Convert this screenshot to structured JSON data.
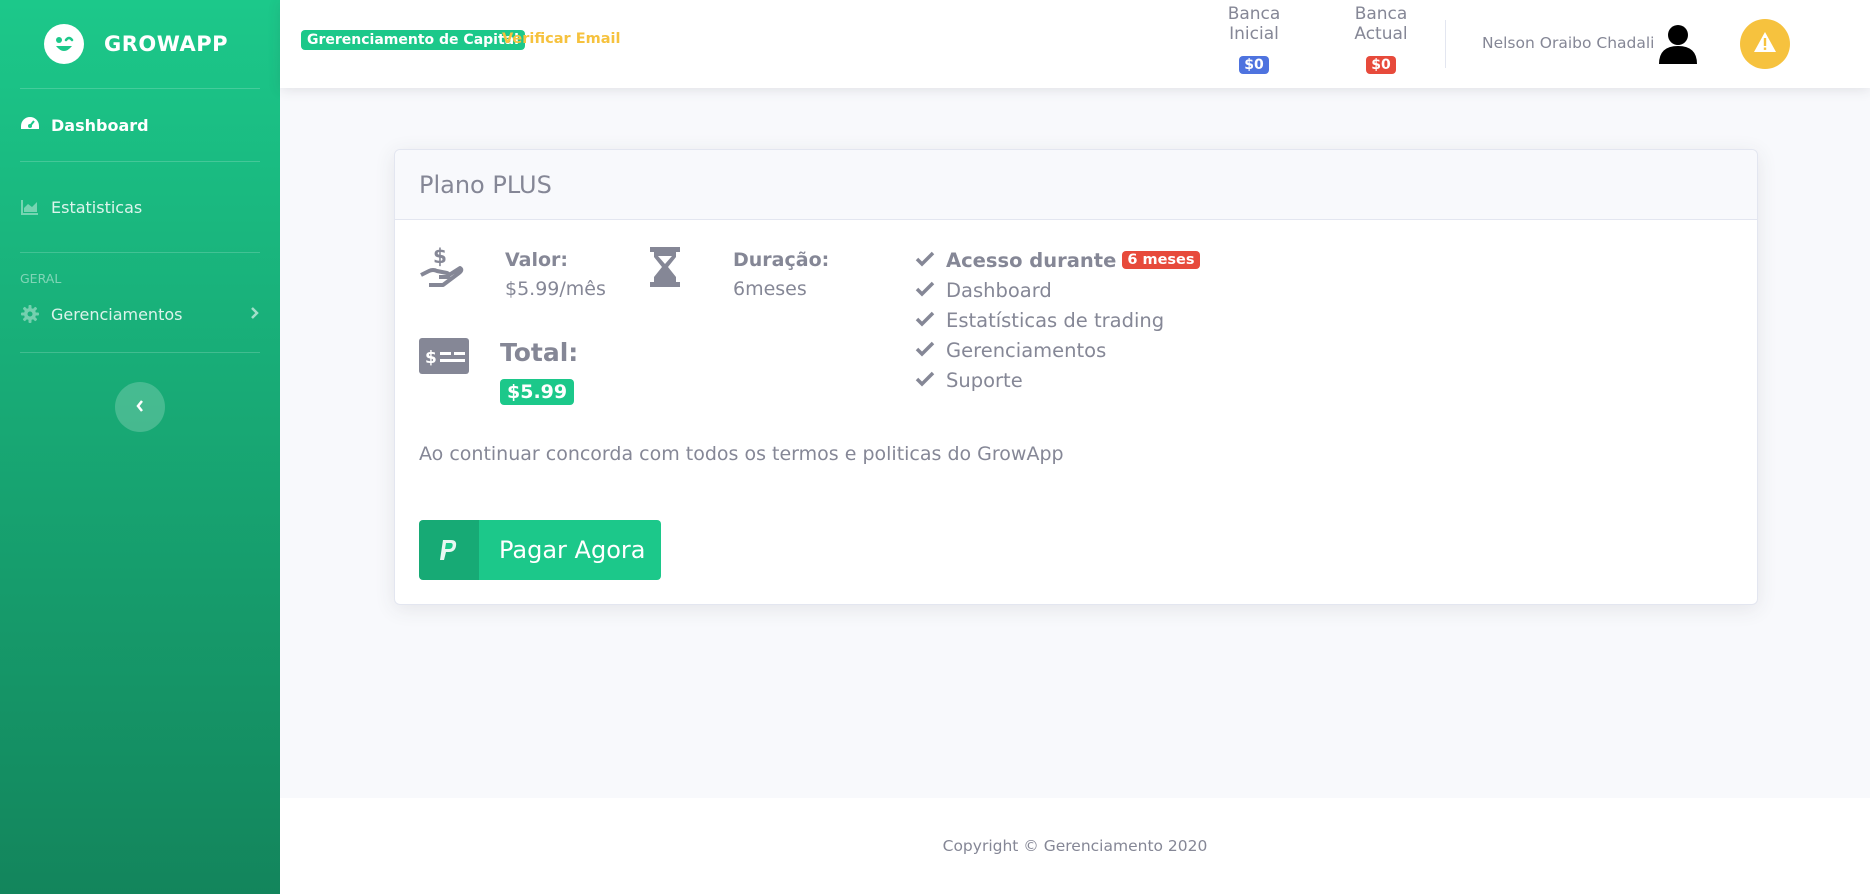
{
  "sidebar": {
    "brand": "GROWAPP",
    "items": [
      {
        "label": "Dashboard"
      },
      {
        "label": "Estatisticas"
      },
      {
        "label": "Gerenciamentos"
      }
    ],
    "heading": "Geral"
  },
  "topbar": {
    "badge": "Grerenciamento de Capital",
    "verify": "Verificar Email",
    "banca_inicial": {
      "label": "Banca Inicial",
      "value": "$0"
    },
    "banca_actual": {
      "label": "Banca Actual",
      "value": "$0"
    },
    "username": "Nelson Oraibo Chadali"
  },
  "plan": {
    "title": "Plano PLUS",
    "valor_label": "Valor:",
    "valor_value": "$5.99/mês",
    "duracao_label": "Duração:",
    "duracao_value": "6meses",
    "total_label": "Total:",
    "total_value": "$5.99",
    "features": [
      {
        "text": "Acesso durante",
        "badge": "6 meses"
      },
      {
        "text": "Dashboard"
      },
      {
        "text": "Estatísticas de trading"
      },
      {
        "text": "Gerenciamentos"
      },
      {
        "text": "Suporte"
      }
    ],
    "terms": "Ao continuar concorda com todos os termos e politicas do GrowApp",
    "pay_button": "Pagar Agora"
  },
  "footer": {
    "copyright": "Copyright © Gerenciamento 2020"
  },
  "colors": {
    "primary": "#1cc88a",
    "danger": "#e74a3b",
    "info": "#4e73df",
    "warning": "#f6c23e",
    "text": "#858796"
  }
}
